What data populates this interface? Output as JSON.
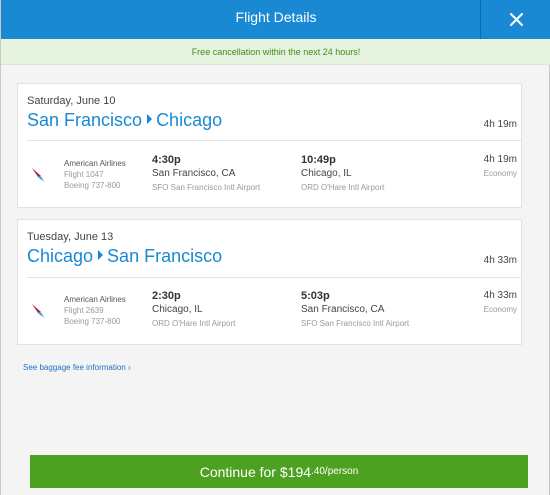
{
  "header": {
    "title": "Flight Details",
    "close_icon": "close-icon"
  },
  "banner": {
    "text": "Free cancellation within the next 24 hours!"
  },
  "trips": [
    {
      "date": "Saturday, June 10",
      "origin": "San Francisco",
      "destination": "Chicago",
      "duration": "4h 19m",
      "segment": {
        "airline": "American Airlines",
        "flight": "Flight 1047",
        "aircraft": "Boeing 737-800",
        "depart_time": "4:30p",
        "depart_city": "San Francisco, CA",
        "depart_airport": "SFO San Francisco Intl Airport",
        "arrive_time": "10:49p",
        "arrive_city": "Chicago, IL",
        "arrive_airport": "ORD O'Hare Intl Airport",
        "duration": "4h 19m",
        "cabin": "Economy"
      }
    },
    {
      "date": "Tuesday, June 13",
      "origin": "Chicago",
      "destination": "San Francisco",
      "duration": "4h 33m",
      "segment": {
        "airline": "American Airlines",
        "flight": "Flight 2639",
        "aircraft": "Boeing 737-800",
        "depart_time": "2:30p",
        "depart_city": "Chicago, IL",
        "depart_airport": "ORD O'Hare Intl Airport",
        "arrive_time": "5:03p",
        "arrive_city": "San Francisco, CA",
        "arrive_airport": "SFO San Francisco Intl Airport",
        "duration": "4h 33m",
        "cabin": "Economy"
      }
    }
  ],
  "baggage_link": "See baggage fee information ›",
  "continue": {
    "prefix": "Continue for ",
    "price_main": "$194",
    "price_cents": ".40/person"
  },
  "colors": {
    "accent": "#1989d3",
    "button": "#4da121",
    "banner_bg": "#e6f3de",
    "banner_text": "#3d8e1e"
  }
}
